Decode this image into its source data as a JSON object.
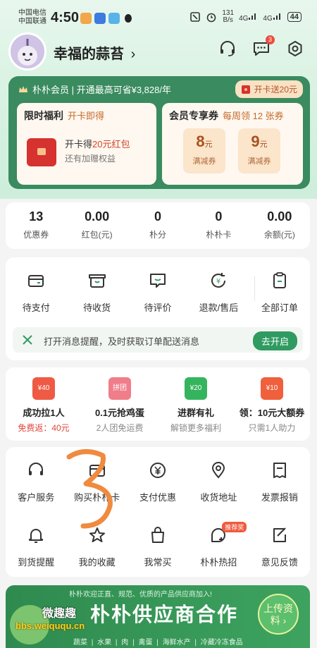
{
  "status_bar": {
    "carrier1": "中国电信",
    "carrier2": "中国联通",
    "time": "4:50",
    "net_speed_top": "131",
    "net_speed_unit": "B/s",
    "signal1": "4G",
    "signal2": "4G",
    "battery": "44"
  },
  "profile": {
    "username": "幸福的蒜苔",
    "chevron": "›",
    "message_badge": "3"
  },
  "membership": {
    "header": "朴朴会员 | 开通最高可省¥3,828/年",
    "open_button": "开卡送20元",
    "limited": {
      "title": "限时福利",
      "subtitle": "开卡即得",
      "line1_prefix": "开卡得",
      "line1_highlight": "20元红包",
      "line2": "还有加赠权益"
    },
    "exclusive": {
      "title": "会员专享券",
      "subtitle": "每周领 12 张券",
      "coupons": [
        {
          "amount": "8",
          "unit": "元",
          "label": "满减券"
        },
        {
          "amount": "9",
          "unit": "元",
          "label": "满减券"
        }
      ]
    }
  },
  "stats": [
    {
      "value": "13",
      "label": "优惠券"
    },
    {
      "value": "0.00",
      "label": "红包(元)"
    },
    {
      "value": "0",
      "label": "朴分"
    },
    {
      "value": "0",
      "label": "朴朴卡"
    },
    {
      "value": "0.00",
      "label": "余额(元)"
    }
  ],
  "orders": [
    {
      "label": "待支付",
      "icon": "wallet-icon"
    },
    {
      "label": "待收货",
      "icon": "delivery-box-icon"
    },
    {
      "label": "待评价",
      "icon": "comment-icon"
    },
    {
      "label": "退款/售后",
      "icon": "refund-icon"
    },
    {
      "label": "全部订单",
      "icon": "clipboard-icon"
    }
  ],
  "notice": {
    "text": "打开消息提醒，及时获取订单配送消息",
    "button": "去开启"
  },
  "promos": [
    {
      "icon_text": "¥40",
      "title": "成功拉1人",
      "sub": "免费返：40元",
      "color": "#ef5a45"
    },
    {
      "icon_text": "拼团",
      "title": "0.1元抢鸡蛋",
      "sub": "2人团免运费",
      "color": "#f07d8a"
    },
    {
      "icon_text": "¥20",
      "title": "进群有礼",
      "sub": "解锁更多福利",
      "color": "#35b45e"
    },
    {
      "icon_text": "¥10",
      "title": "领：10元大额券",
      "sub": "只需1人助力",
      "color": "#f0603c"
    }
  ],
  "services": [
    {
      "label": "客户服务",
      "icon": "headset-icon"
    },
    {
      "label": "购买朴朴卡",
      "icon": "card-icon"
    },
    {
      "label": "支付优惠",
      "icon": "yuan-icon"
    },
    {
      "label": "收货地址",
      "icon": "location-pin-icon"
    },
    {
      "label": "发票报销",
      "icon": "invoice-icon"
    },
    {
      "label": "到货提醒",
      "icon": "bell-icon"
    },
    {
      "label": "我的收藏",
      "icon": "star-icon"
    },
    {
      "label": "我常买",
      "icon": "shopping-bag-icon"
    },
    {
      "label": "朴朴热招",
      "icon": "recruit-icon",
      "badge": "推荐奖"
    },
    {
      "label": "意见反馈",
      "icon": "feedback-icon"
    }
  ],
  "banner": {
    "top_text": "朴朴欢迎正直、规范、优质的产品供应商加入!",
    "title": "朴朴供应商合作",
    "button": "上传资料",
    "button_arrow": "›",
    "bottom_text": "蔬菜 | 水果 | 肉 | 禽蛋 | 海鲜水产 | 冷藏冷冻食品"
  },
  "watermark": {
    "line1": "微趣趣",
    "line2": "bbs.weiququ.cn"
  },
  "colors": {
    "brand_green": "#3a8b5f",
    "accent_red": "#e0453b",
    "notice_button": "#2f9b60"
  }
}
